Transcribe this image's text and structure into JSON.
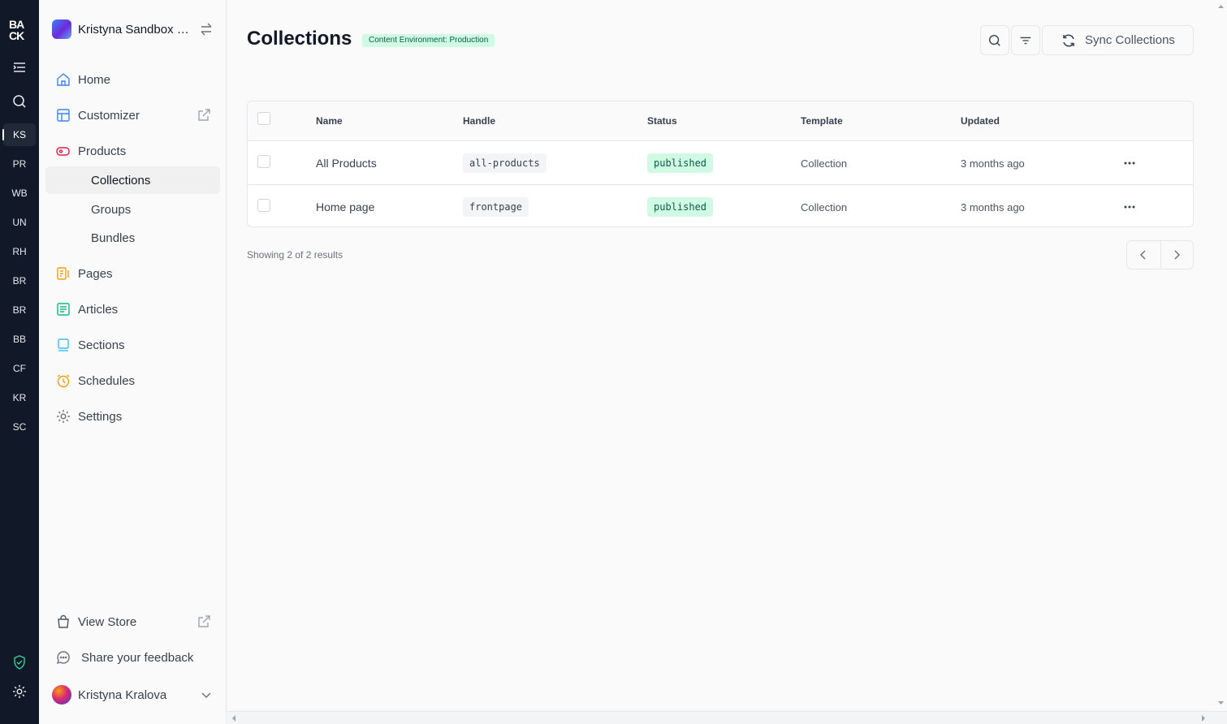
{
  "rail": {
    "logo": "BACK",
    "workspaces": [
      "KS",
      "PR",
      "WB",
      "UN",
      "RH",
      "BR",
      "BR",
      "BB",
      "CF",
      "KR",
      "SC"
    ],
    "active_workspace": "KS",
    "icons": [
      "menu-icon",
      "search-icon",
      "shield-check-icon",
      "gear-icon"
    ]
  },
  "sidebar": {
    "store_name": "Kristyna Sandbox Store",
    "nav": {
      "home": "Home",
      "customizer": "Customizer",
      "products": "Products",
      "collections": "Collections",
      "groups": "Groups",
      "bundles": "Bundles",
      "pages": "Pages",
      "articles": "Articles",
      "sections": "Sections",
      "schedules": "Schedules",
      "settings": "Settings"
    },
    "view_store": "View Store",
    "feedback": "Share your feedback",
    "user_name": "Kristyna Kralova"
  },
  "main": {
    "title": "Collections",
    "env_badge": "Content Environment: Production",
    "sync_label": "Sync Collections",
    "table": {
      "headers": {
        "name": "Name",
        "handle": "Handle",
        "status": "Status",
        "template": "Template",
        "updated": "Updated"
      },
      "rows": [
        {
          "name": "All Products",
          "handle": "all-products",
          "status": "published",
          "template": "Collection",
          "updated": "3 months ago"
        },
        {
          "name": "Home page",
          "handle": "frontpage",
          "status": "published",
          "template": "Collection",
          "updated": "3 months ago"
        }
      ]
    },
    "results_text": "Showing 2 of 2 results"
  },
  "colors": {
    "rail_bg": "#111827",
    "badge_bg": "#d1fae5",
    "badge_text": "#065f46"
  }
}
